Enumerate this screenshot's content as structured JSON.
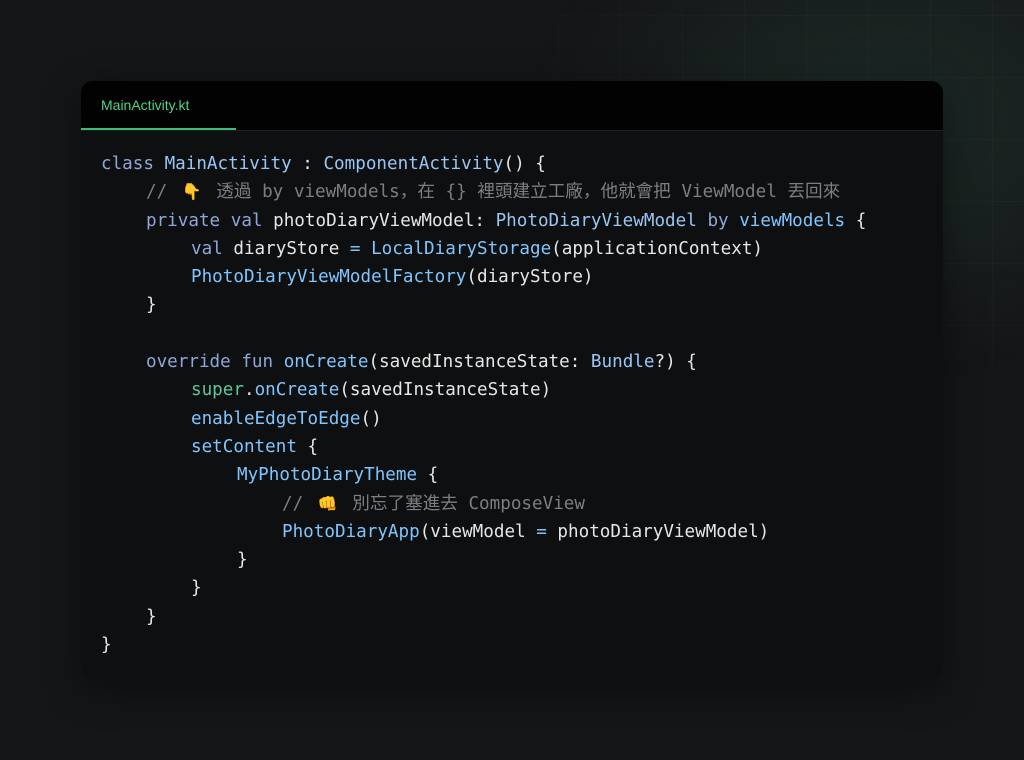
{
  "tab": {
    "label": "MainActivity.kt"
  },
  "code": {
    "l1": {
      "kw": "class",
      "cls": "MainActivity",
      "colon": " : ",
      "sup": "ComponentActivity",
      "rest": "() {"
    },
    "l2": {
      "slashes": "//",
      "emoji": "👇",
      "text": "透過 by viewModels，在 {} 裡頭建立工廠，他就會把 ViewModel 丟回來"
    },
    "l3": {
      "kw1": "private",
      "kw2": "val",
      "name": "photoDiaryViewModel",
      "colon": ": ",
      "type": "PhotoDiaryViewModel",
      "by": "by",
      "deleg": "viewModels",
      "brace": " {"
    },
    "l4": {
      "kw": "val",
      "name": "diaryStore",
      "eq": "=",
      "call": "LocalDiaryStorage",
      "args": "(applicationContext)"
    },
    "l5": {
      "call": "PhotoDiaryViewModelFactory",
      "args": "(diaryStore)"
    },
    "l6": {
      "text": "}"
    },
    "l8": {
      "kw1": "override",
      "kw2": "fun",
      "fn": "onCreate",
      "p1": "(savedInstanceState: ",
      "type": "Bundle",
      "p2": "?) {"
    },
    "l9": {
      "kw": "super",
      "dot": ".",
      "fn": "onCreate",
      "args": "(savedInstanceState)"
    },
    "l10": {
      "fn": "enableEdgeToEdge",
      "args": "()"
    },
    "l11": {
      "fn": "setContent",
      "brace": " {"
    },
    "l12": {
      "fn": "MyPhotoDiaryTheme",
      "brace": " {"
    },
    "l13": {
      "slashes": "//",
      "emoji": "👊",
      "text": "別忘了塞進去 ComposeView"
    },
    "l14": {
      "fn": "PhotoDiaryApp",
      "p1": "(viewModel ",
      "eq": "=",
      "p2": " photoDiaryViewModel)"
    },
    "l15": {
      "text": "}"
    },
    "l16": {
      "text": "}"
    },
    "l17": {
      "text": "}"
    },
    "l18": {
      "text": "}"
    }
  },
  "colors": {
    "accent": "#4fd28c",
    "keyword": "#8fa7d8",
    "type": "#98c6f5",
    "comment": "#7b7f84"
  },
  "icons": {
    "comment1": "backhand-index-pointing-down-emoji",
    "comment2": "oncoming-fist-emoji"
  }
}
